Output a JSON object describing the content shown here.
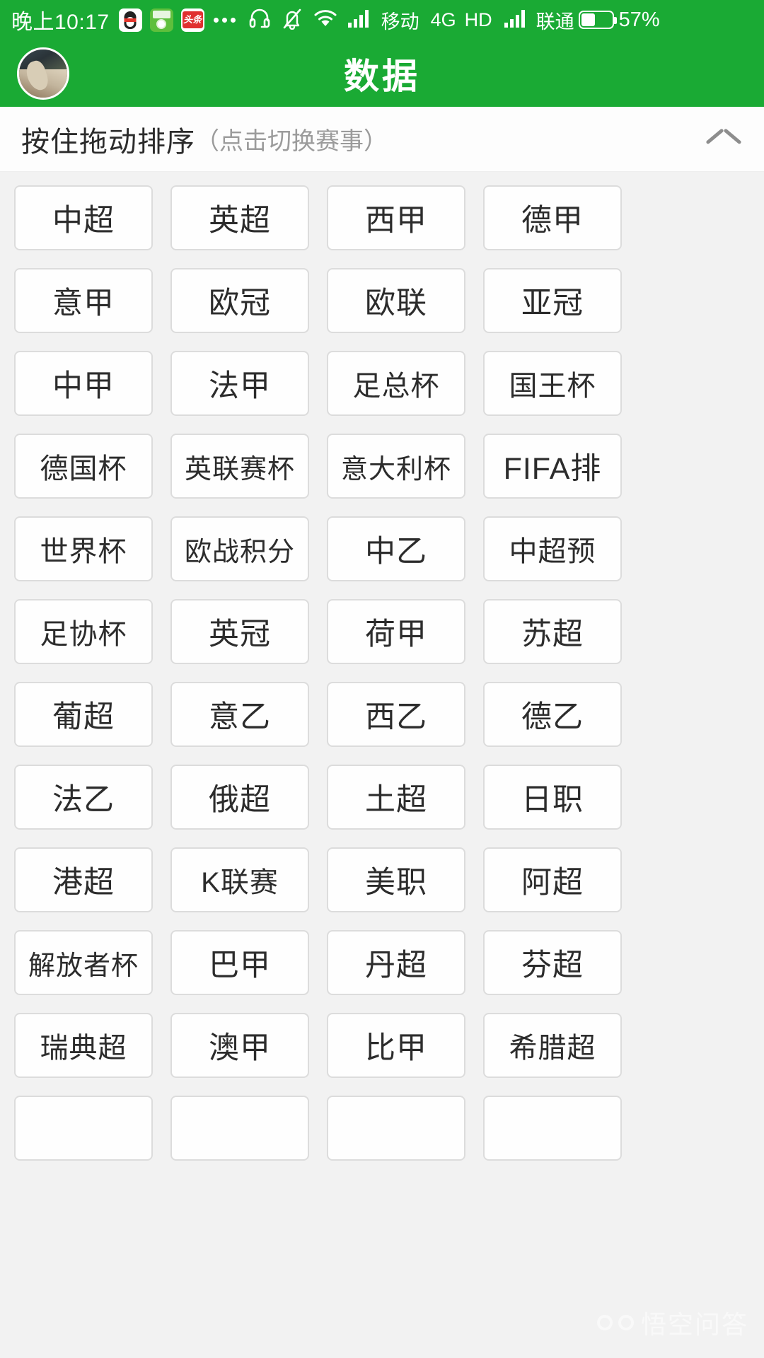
{
  "status_bar": {
    "time": "晚上10:17",
    "app_icons": [
      "qq-icon",
      "green-app-icon",
      "toutiao-icon"
    ],
    "toutiao_label": "头条",
    "overflow": "more-dots-icon",
    "headset": "headset-icon",
    "mute": "bell-muted-icon",
    "wifi": "wifi-icon",
    "signal1": "signal-bars-icon",
    "carrier1": "移动",
    "network": "4G",
    "hd": "HD",
    "signal2": "signal-bars-icon",
    "carrier2": "联通",
    "battery_icon": "battery-icon",
    "battery_percent": "57%"
  },
  "app_bar": {
    "avatar": "user-avatar",
    "title": "数据"
  },
  "sort_bar": {
    "main_label": "按住拖动排序",
    "sub_label": "（点击切换赛事）",
    "collapse_icon": "chevron-up-icon"
  },
  "leagues": [
    "中超",
    "英超",
    "西甲",
    "德甲",
    "意甲",
    "欧冠",
    "欧联",
    "亚冠",
    "中甲",
    "法甲",
    "足总杯",
    "国王杯",
    "德国杯",
    "英联赛杯",
    "意大利杯",
    "FIFA排",
    "世界杯",
    "欧战积分",
    "中乙",
    "中超预",
    "足协杯",
    "英冠",
    "荷甲",
    "苏超",
    "葡超",
    "意乙",
    "西乙",
    "德乙",
    "法乙",
    "俄超",
    "土超",
    "日职",
    "港超",
    "K联赛",
    "美职",
    "阿超",
    "解放者杯",
    "巴甲",
    "丹超",
    "芬超",
    "瑞典超",
    "澳甲",
    "比甲",
    "希腊超",
    "",
    "",
    "",
    ""
  ],
  "watermark": {
    "logo": "wukong-logo-icon",
    "text": "悟空问答"
  },
  "colors": {
    "brand_green": "#1aaa34",
    "page_bg": "#f2f2f2",
    "cell_bg": "#fefefe",
    "cell_border": "#dcdcdc",
    "text_primary": "#2c2c2c",
    "text_muted": "#9b9b9b"
  }
}
